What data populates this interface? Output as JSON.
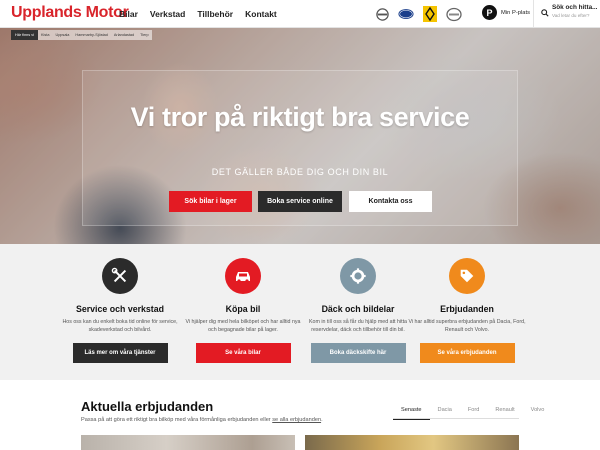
{
  "header": {
    "logo": "Upplands Motor",
    "nav": [
      "Bilar",
      "Verkstad",
      "Tillbehör",
      "Kontakt"
    ],
    "brands": [
      "volvo-logo-icon",
      "ford-logo-icon",
      "renault-logo-icon",
      "dacia-logo-icon"
    ],
    "parking_letter": "P",
    "parking_label": "Min P-plats",
    "search_title": "Sök och hitta...",
    "search_placeholder": "Vad letar du efter?"
  },
  "breadcrumb": {
    "here_label": "Här finns vi",
    "items": [
      "Kista",
      "Uppsala",
      "Hammarby-Sjöstad",
      "Arlandastad",
      "Tierp"
    ]
  },
  "hero": {
    "title": "Vi tror på riktigt bra service",
    "subtitle": "DET GÄLLER BÅDE DIG OCH DIN BIL",
    "buttons": [
      "Sök bilar i lager",
      "Boka service online",
      "Kontakta oss"
    ]
  },
  "services": [
    {
      "title": "Service och verkstad",
      "desc": "Hos oss kan du enkelt boka tid online för service, skadeverkstad och bilvård.",
      "button": "Läs mer om våra tjänster",
      "icon": "wrench-screwdriver-icon",
      "color": "#2b2b2b",
      "button_color": "#2b2b2b"
    },
    {
      "title": "Köpa bil",
      "desc": "Vi hjälper dig med hela bilköpet och har alltid nya och begagnade bilar på lager.",
      "button": "Se våra bilar",
      "icon": "car-icon",
      "color": "#e31b23",
      "button_color": "#e31b23"
    },
    {
      "title": "Däck och bildelar",
      "desc": "Kom in till oss så får du hjälp med att hitta reservdelar, däck och tillbehör till din bil.",
      "button": "Boka däckskifte här",
      "icon": "gear-icon",
      "color": "#7f98a6",
      "button_color": "#7f98a6"
    },
    {
      "title": "Erbjudanden",
      "desc": "Vi har alltid superbra erbjudanden på Dacia, Ford, Renault och Volvo.",
      "button": "Se våra erbjudanden",
      "icon": "price-tag-icon",
      "color": "#f08a1c",
      "button_color": "#f08a1c"
    }
  ],
  "offers": {
    "title": "Aktuella erbjudanden",
    "desc_text": "Passa på att göra ett riktigt bra bilköp med våra förmånliga erbjudanden eller",
    "desc_link": "se alla erbjudanden",
    "tabs": [
      "Senaste",
      "Dacia",
      "Ford",
      "Renault",
      "Volvo"
    ]
  }
}
